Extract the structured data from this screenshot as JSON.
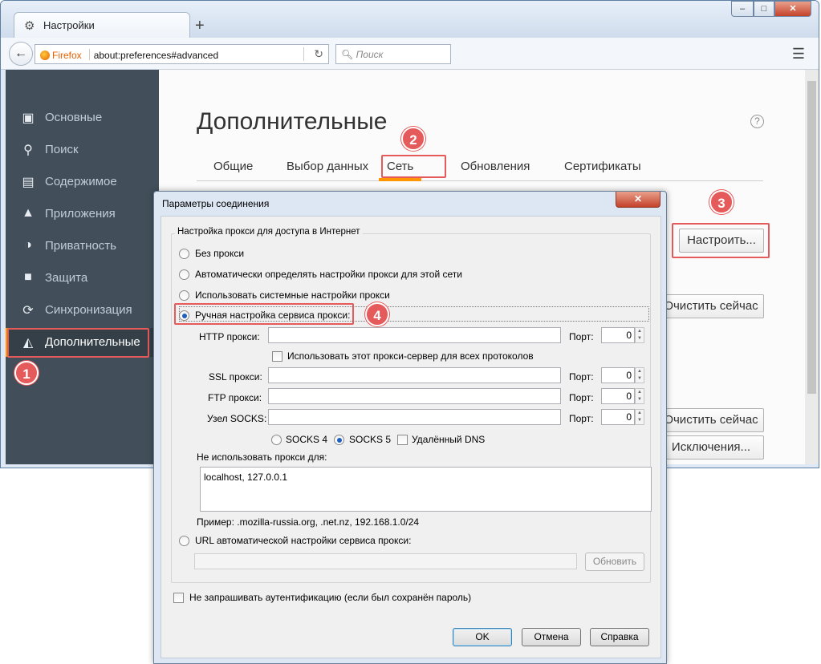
{
  "browser": {
    "tab_title": "Настройки",
    "new_tab": "+",
    "window_buttons": {
      "min": "–",
      "max": "□",
      "close": "✕"
    },
    "url_identity": "Firefox",
    "url": "about:preferences#advanced",
    "search_placeholder": "Поиск"
  },
  "sidebar": {
    "items": [
      {
        "label": "Основные",
        "icon": "general-icon"
      },
      {
        "label": "Поиск",
        "icon": "search-icon"
      },
      {
        "label": "Содержимое",
        "icon": "document-icon"
      },
      {
        "label": "Приложения",
        "icon": "rocket-icon"
      },
      {
        "label": "Приватность",
        "icon": "mask-icon"
      },
      {
        "label": "Защита",
        "icon": "lock-icon"
      },
      {
        "label": "Синхронизация",
        "icon": "sync-icon"
      },
      {
        "label": "Дополнительные",
        "icon": "wizard-hat-icon",
        "selected": true
      }
    ]
  },
  "main": {
    "title": "Дополнительные",
    "help": "?",
    "tabs": [
      "Общие",
      "Выбор данных",
      "Сеть",
      "Обновления",
      "Сертификаты"
    ],
    "selected_tab": "Сеть",
    "configure_button": "Настроить...",
    "clear_now_1": "Очистить сейчас",
    "clear_now_2": "Очистить сейчас",
    "exceptions": "Исключения..."
  },
  "annotations": {
    "b1": "1",
    "b2": "2",
    "b3": "3",
    "b4": "4",
    "color": "#e55a5a",
    "accent": "#ff9500"
  },
  "dialog": {
    "title": "Параметры соединения",
    "close": "✕",
    "group_label": "Настройка прокси для доступа в Интернет",
    "options": {
      "no_proxy": "Без прокси",
      "auto_detect": "Автоматически определять настройки прокси для этой сети",
      "system": "Использовать системные настройки прокси",
      "manual": "Ручная настройка сервиса прокси:",
      "pac": "URL автоматической настройки сервиса прокси:"
    },
    "selected_option": "manual",
    "http_label": "HTTP прокси:",
    "ssl_label": "SSL прокси:",
    "ftp_label": "FTP прокси:",
    "socks_label": "Узел SOCKS:",
    "port_label": "Порт:",
    "ports": {
      "http": "0",
      "ssl": "0",
      "ftp": "0",
      "socks": "0"
    },
    "use_for_all": "Использовать этот прокси-сервер для всех протоколов",
    "socks4": "SOCKS 4",
    "socks5": "SOCKS 5",
    "socks_selected": "SOCKS 5",
    "remote_dns": "Удалённый DNS",
    "no_proxy_for_label": "Не использовать прокси для:",
    "no_proxy_for_value": "localhost, 127.0.0.1",
    "example": "Пример: .mozilla-russia.org, .net.nz, 192.168.1.0/24",
    "reload": "Обновить",
    "no_auth_prompt": "Не запрашивать аутентификацию (если был сохранён пароль)",
    "ok": "OK",
    "cancel": "Отмена",
    "help_btn": "Справка"
  }
}
